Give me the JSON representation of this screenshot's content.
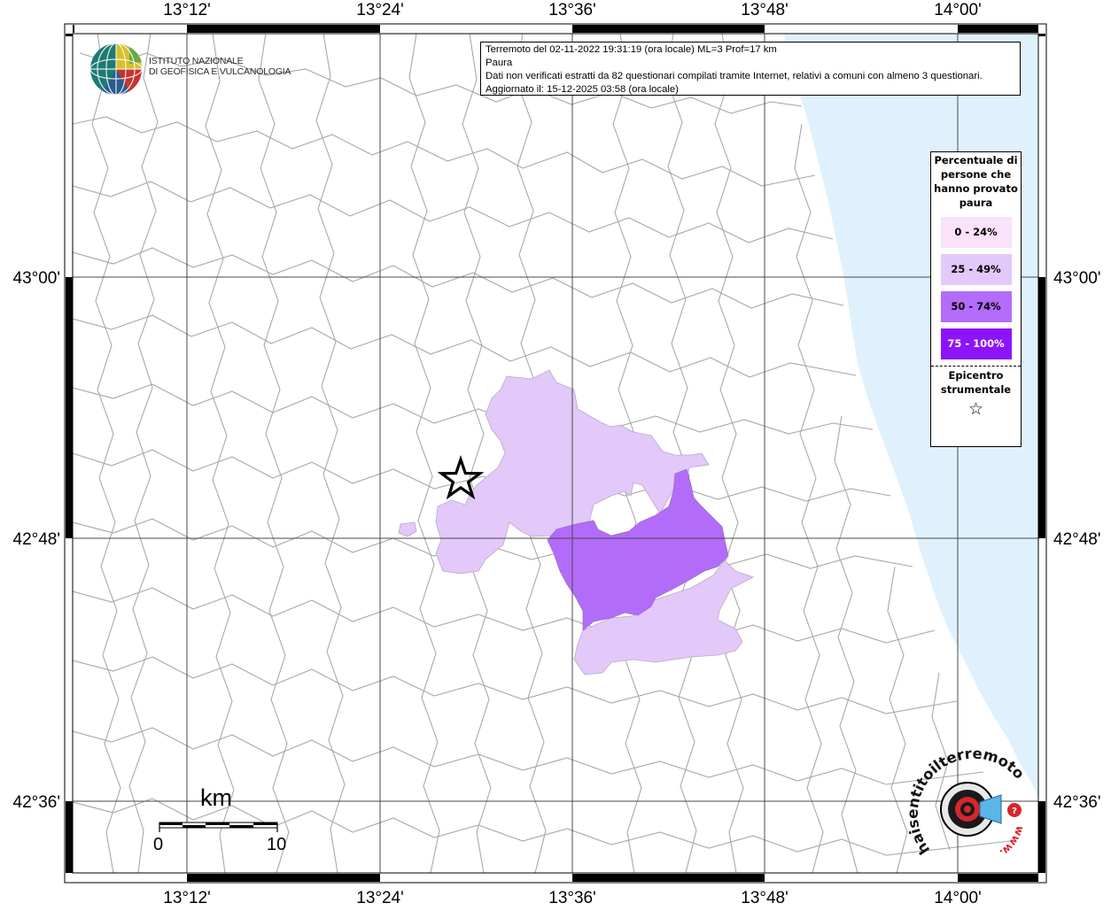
{
  "info": {
    "line1": "Terremoto del 02-11-2022 19:31:19 (ora locale) ML=3 Prof=17 km",
    "line2": "Paura",
    "line3": "Dati non verificati estratti da 82 questionari compilati tramite Internet, relativi a comuni con almeno 3 questionari.",
    "line4": "Aggiornato il: 15-12-2025 03:58 (ora locale)"
  },
  "logo": {
    "line1": "ISTITUTO NAZIONALE",
    "line2": "DI GEOFISICA E VULCANOLOGIA",
    "icon": "ingv-globe-logo"
  },
  "watermark": {
    "text": "haisentitoilterremoto.it",
    "prefix": "www.",
    "icon": "megaphone-logo"
  },
  "axes": {
    "lon_labels": [
      "13°12'",
      "13°24'",
      "13°36'",
      "13°48'",
      "14°00'"
    ],
    "lat_labels": [
      "43°00'",
      "42°48'",
      "42°36'"
    ]
  },
  "scale": {
    "unit": "km",
    "start": "0",
    "end": "10"
  },
  "legend": {
    "title": "Percentuale di persone che hanno provato paura",
    "items": [
      {
        "label": "0 - 24%",
        "color": "#fae2fa",
        "text_color": "#000000"
      },
      {
        "label": "25 - 49%",
        "color": "#e2c9fa",
        "text_color": "#000000"
      },
      {
        "label": "50 - 74%",
        "color": "#b36bfa",
        "text_color": "#000000"
      },
      {
        "label": "75 - 100%",
        "color": "#8d14fa",
        "text_color": "#ffffff"
      }
    ],
    "epicenter_label": "Epicentro strumentale",
    "epicenter_symbol": "☆"
  },
  "colors": {
    "sea": "#dff1fd",
    "border_lines": "#a8a8a8"
  }
}
